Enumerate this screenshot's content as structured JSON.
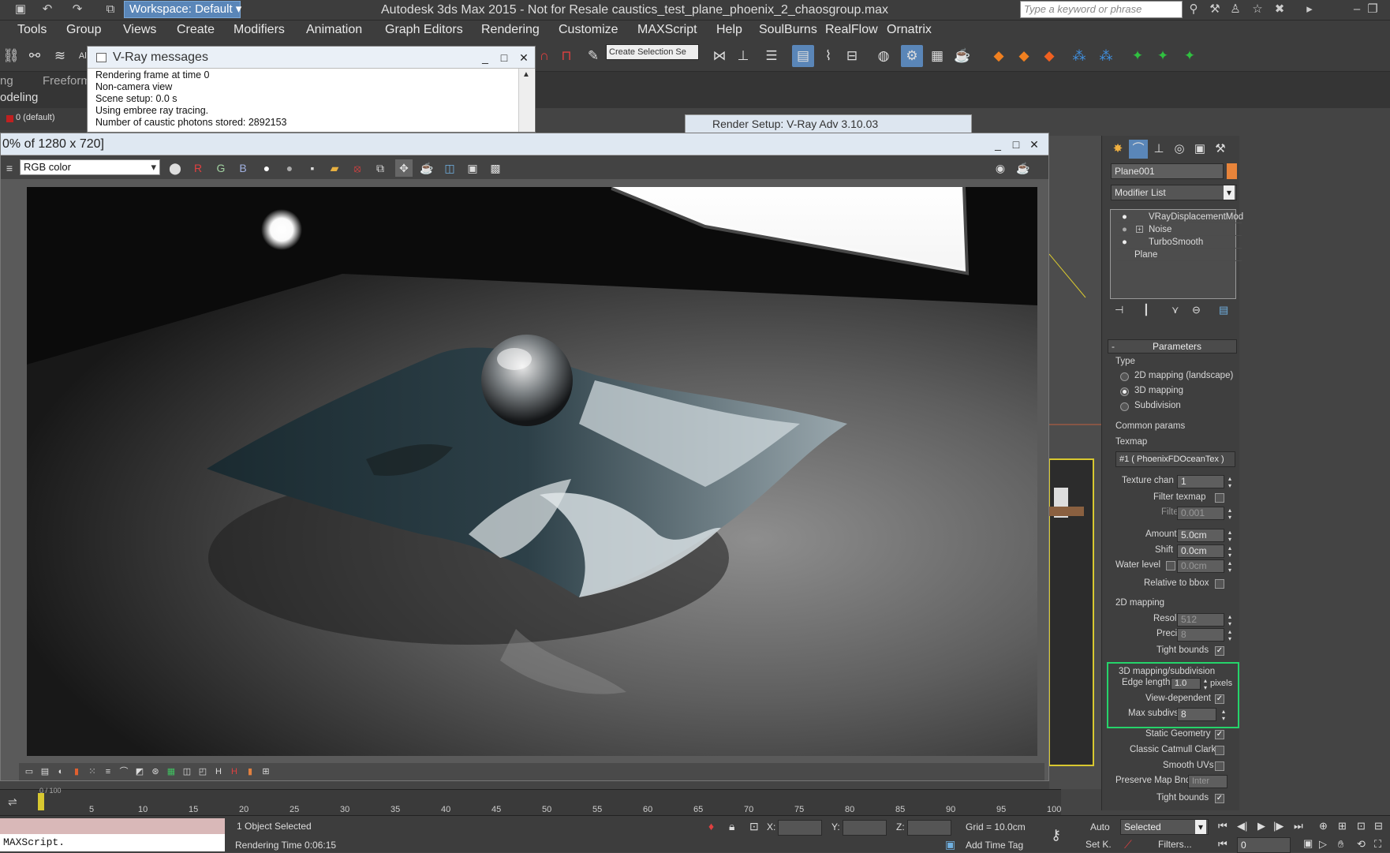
{
  "window": {
    "title": "Autodesk 3ds Max  2015   - Not for Resale   caustics_test_plane_phoenix_2_chaosgroup.max",
    "workspace_label": "Workspace: Default",
    "search_placeholder": "Type a keyword or phrase"
  },
  "menu": {
    "items": [
      "Tools",
      "Group",
      "Views",
      "Create",
      "Modifiers",
      "Animation",
      "Graph Editors",
      "Rendering",
      "Customize",
      "MAXScript",
      "Help",
      "SoulBurns",
      "RealFlow",
      "Ornatrix"
    ]
  },
  "toolbar": {
    "selection_set_placeholder": "Create Selection Se",
    "all_label": "All"
  },
  "ribbon": {
    "tab_modeling": "odeling",
    "tab_freeform": "Freeform",
    "tab_ng": "ng",
    "layer_label": "0 (default)"
  },
  "vray_messages": {
    "title": "V-Ray messages",
    "lines": [
      "Rendering frame at time 0",
      "Non-camera view",
      "Scene setup: 0.0 s",
      "Using embree ray tracing.",
      "Number of caustic photons stored: 2892153"
    ]
  },
  "render_setup_bar": {
    "title": "Render Setup: V-Ray Adv 3.10.03"
  },
  "frame_buffer": {
    "title": "0% of 1280 x 720]",
    "channel": "RGB color",
    "btn_r": "R",
    "btn_g": "G",
    "btn_b": "B"
  },
  "command_panel": {
    "object_name": "Plane001",
    "object_color": "#e8843a",
    "modifier_list_label": "Modifier List",
    "stack": [
      "VRayDisplacementMod",
      "Noise",
      "TurboSmooth",
      "Plane"
    ],
    "rollout_title": "Parameters",
    "type_group": "Type",
    "type_options": [
      "2D mapping (landscape)",
      "3D mapping",
      "Subdivision"
    ],
    "type_selected": "3D mapping",
    "common_params": "Common params",
    "texmap_label": "Texmap",
    "texmap_value": "#1  ( PhoenixFDOceanTex )",
    "texture_chan_label": "Texture chan",
    "texture_chan_value": "1",
    "filter_texmap_label": "Filter texmap",
    "filter_blur_label": "Filter blur",
    "filter_blur_value": "0.001",
    "amount_label": "Amount",
    "amount_value": "5.0cm",
    "shift_label": "Shift",
    "shift_value": "0.0cm",
    "water_level_label": "Water level",
    "water_level_value": "0.0cm",
    "relative_bbox_label": "Relative to bbox",
    "mapping2d_group": "2D mapping",
    "resolution_label": "Resolution",
    "resolution_value": "512",
    "precision_label": "Precision",
    "precision_value": "8",
    "tight_bounds_label": "Tight bounds",
    "mapping3d_group": "3D mapping/subdivision",
    "edge_length_label": "Edge length",
    "edge_length_value": "1.0",
    "pixels_label": "pixels",
    "view_dependent_label": "View-dependent",
    "max_subdivs_label": "Max subdivs",
    "max_subdivs_value": "8",
    "static_geometry_label": "Static Geometry",
    "classic_catmull_label": "Classic Catmull Clark",
    "smooth_uvs_label": "Smooth UVs",
    "preserve_map_label": "Preserve Map Bnd",
    "preserve_map_value": "Inter",
    "tight_bounds2_label": "Tight bounds",
    "highlight_color": "#25d36a"
  },
  "timeline": {
    "ticks": [
      "5",
      "10",
      "15",
      "20",
      "25",
      "30",
      "35",
      "40",
      "45",
      "50",
      "55",
      "60",
      "65",
      "70",
      "75",
      "80",
      "85",
      "90",
      "95",
      "100"
    ],
    "frame_label": "0 / 100"
  },
  "status": {
    "maxscript": "MAXScript.",
    "selection_text": "1 Object Selected",
    "render_time": "Rendering Time  0:06:15",
    "x_label": "X:",
    "y_label": "Y:",
    "z_label": "Z:",
    "grid": "Grid = 10.0cm",
    "add_time_tag": "Add Time Tag",
    "auto_label": "Auto",
    "set_key_label": "Set K.",
    "selected_dropdown": "Selected",
    "filters_label": "Filters...",
    "frame_value": "0"
  }
}
